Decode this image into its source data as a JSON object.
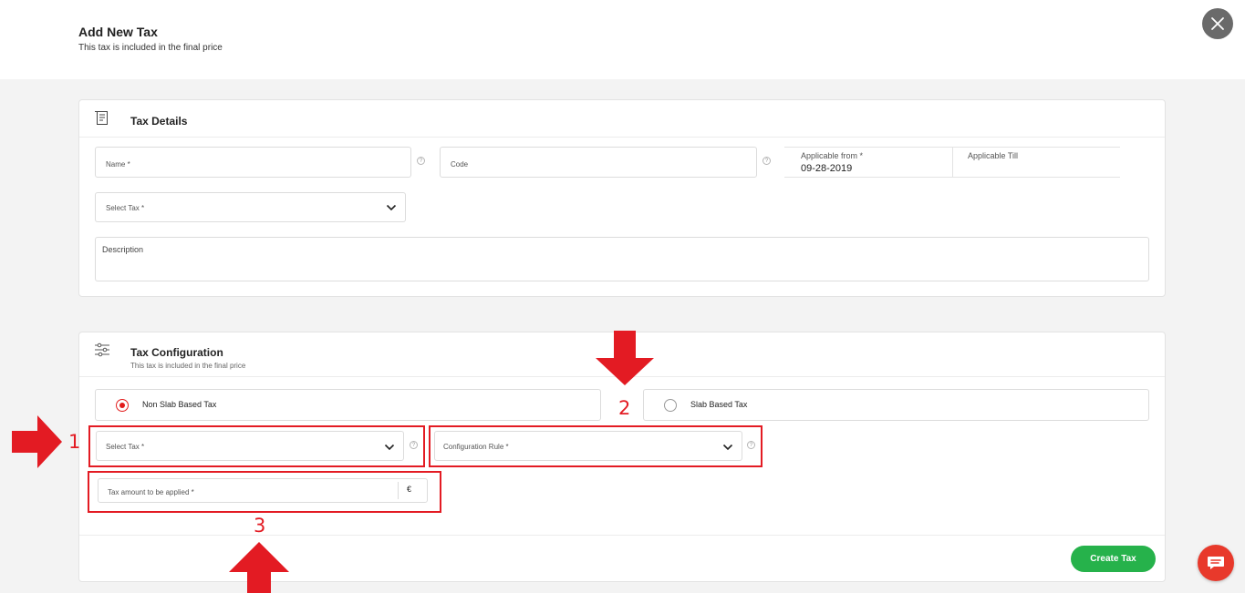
{
  "header": {
    "title": "Add New Tax",
    "subtitle": "This tax is included in the final price",
    "close_icon": "close-icon"
  },
  "tax_details": {
    "title": "Tax Details",
    "icon": "receipt-icon",
    "name_placeholder": "Name *",
    "code_placeholder": "Code",
    "applicable_from_label": "Applicable from *",
    "applicable_from_value": "09-28-2019",
    "applicable_till_label": "Applicable Till",
    "select_tax_placeholder": "Select Tax *",
    "description_label": "Description"
  },
  "tax_configuration": {
    "title": "Tax Configuration",
    "subtitle": "This tax is included in the final price",
    "icon": "sliders-icon",
    "options": [
      {
        "label": "Non Slab Based Tax",
        "selected": true
      },
      {
        "label": "Slab Based Tax",
        "selected": false
      }
    ],
    "select_tax_placeholder": "Select Tax *",
    "configuration_rule_placeholder": "Configuration Rule *",
    "tax_amount_placeholder": "Tax amount to be applied *",
    "currency_symbol": "€"
  },
  "annotations": {
    "labels": [
      "1",
      "2",
      "3"
    ],
    "color": "#e31b23"
  },
  "actions": {
    "create_label": "Create Tax",
    "create_color": "#26b24b",
    "chat_icon": "chat-icon",
    "chat_color": "#e8392b"
  }
}
